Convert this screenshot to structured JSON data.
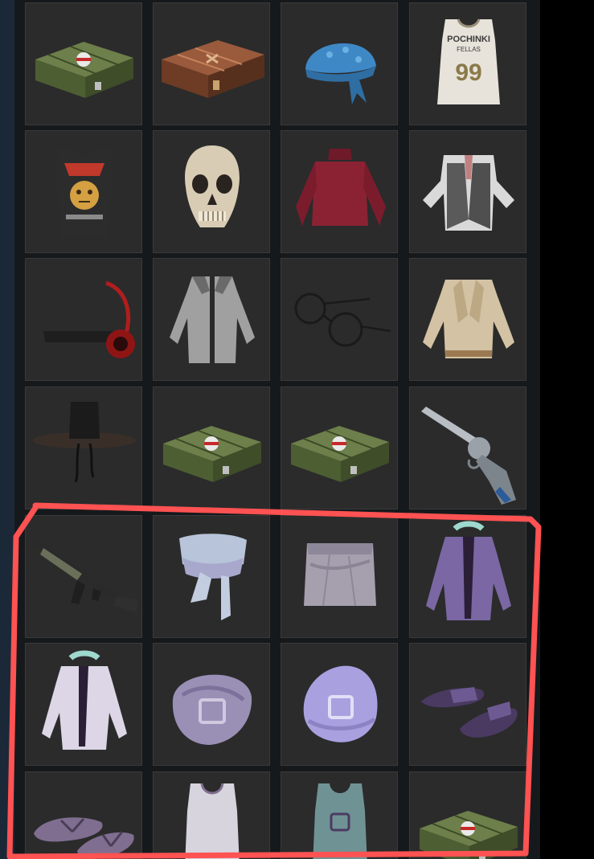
{
  "colors": {
    "page_bg": "#000000",
    "rail_bg": "#1b2838",
    "panel_bg": "#16191c",
    "tile_bg": "#2b2b2b",
    "tile_border": "#3a3a3a",
    "annotation_stroke": "#ff5252"
  },
  "jersey": {
    "name": "POCHINKI",
    "subtitle": "FELLAS",
    "number": "99"
  },
  "items": [
    {
      "icon": "military-crate-icon"
    },
    {
      "icon": "copper-crate-icon"
    },
    {
      "icon": "blue-bandana-icon"
    },
    {
      "icon": "pochinki-jersey-icon"
    },
    {
      "icon": "leopard-tank-top-icon"
    },
    {
      "icon": "skull-mask-icon"
    },
    {
      "icon": "red-turtleneck-icon"
    },
    {
      "icon": "plaid-vest-shirt-icon"
    },
    {
      "icon": "beanie-headphones-icon"
    },
    {
      "icon": "grey-jacket-icon"
    },
    {
      "icon": "round-glasses-icon"
    },
    {
      "icon": "beige-blazer-icon"
    },
    {
      "icon": "wide-brim-hat-icon"
    },
    {
      "icon": "military-crate-icon"
    },
    {
      "icon": "military-crate-icon"
    },
    {
      "icon": "revolver-icon"
    },
    {
      "icon": "assault-rifle-icon"
    },
    {
      "icon": "lavender-scarf-icon"
    },
    {
      "icon": "towel-skirt-icon"
    },
    {
      "icon": "purple-bathrobe-icon"
    },
    {
      "icon": "white-bathrobe-icon"
    },
    {
      "icon": "towel-turban-icon"
    },
    {
      "icon": "lavender-towel-turban-icon"
    },
    {
      "icon": "purple-slippers-icon"
    },
    {
      "icon": "flip-flops-icon"
    },
    {
      "icon": "white-tank-top-icon"
    },
    {
      "icon": "teal-tank-top-icon"
    },
    {
      "icon": "military-crate-icon"
    }
  ],
  "annotation": {
    "type": "hand-drawn-outline",
    "encloses_rows": "5-7"
  }
}
